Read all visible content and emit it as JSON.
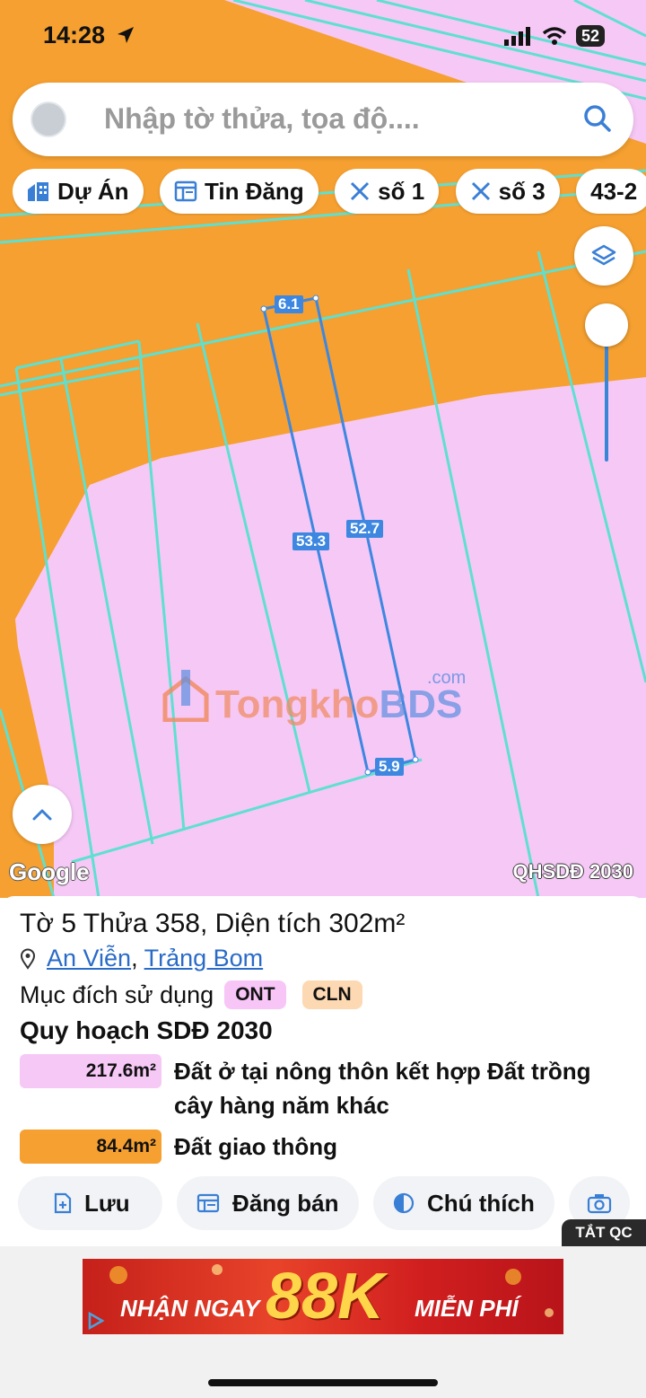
{
  "status_bar": {
    "time": "14:28",
    "battery": "52"
  },
  "search": {
    "placeholder": "Nhập tờ thửa, tọa độ...."
  },
  "chips": [
    {
      "label": "Dự Án",
      "icon": "building-icon"
    },
    {
      "label": "Tin Đăng",
      "icon": "listing-icon"
    },
    {
      "label": "số 1",
      "icon": "ruler-icon"
    },
    {
      "label": "số 3",
      "icon": "ruler-icon"
    },
    {
      "label": "43-2"
    }
  ],
  "map": {
    "dimensions": {
      "top": "6.1",
      "left": "53.3",
      "right": "52.7",
      "bottom": "5.9"
    },
    "watermark": {
      "main_a": "Tongkho",
      "main_b": "BDS",
      "suffix": ".com"
    },
    "google": "Google",
    "badge": "QHSDĐ 2030",
    "colors": {
      "orange": "#f5a030",
      "pink": "#f6c8f6",
      "line": "#5ee0d0",
      "selected": "#3d87e0"
    }
  },
  "parcel": {
    "title": "Tờ 5 Thửa 358, Diện tích 302m²",
    "commune": "An Viễn",
    "separator": ",",
    "district": "Trảng Bom",
    "purpose_label": "Mục đích sử dụng",
    "tags": [
      "ONT",
      "CLN"
    ],
    "plan_title": "Quy hoạch SDĐ 2030",
    "areas": [
      {
        "value": "217.6m²",
        "label": "Đất ở tại nông thôn kết hợp Đất trồng cây hàng năm khác",
        "color": "#f6c8f6"
      },
      {
        "value": "84.4m²",
        "label": "Đất giao thông",
        "color": "#f5a030"
      }
    ]
  },
  "actions": [
    {
      "label": "Lưu",
      "icon": "save-icon"
    },
    {
      "label": "Đăng bán",
      "icon": "post-icon"
    },
    {
      "label": "Chú thích",
      "icon": "legend-icon"
    }
  ],
  "ad": {
    "close_label": "TẮT QC",
    "text_1": "NHẬN NGAY",
    "text_amount": "88K",
    "text_2": "MIỄN PHÍ"
  }
}
